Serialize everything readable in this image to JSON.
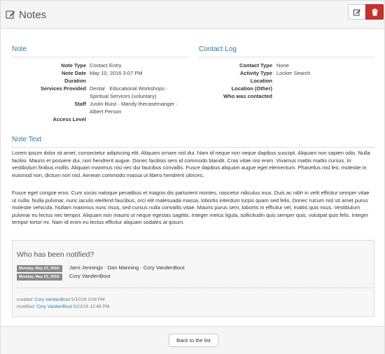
{
  "header": {
    "title": "Notes",
    "edit_icon": "edit-icon",
    "delete_icon": "trash-icon"
  },
  "note": {
    "title": "Note",
    "fields": {
      "note_type_label": "Note Type",
      "note_type_value": "Contact Entry",
      "note_date_label": "Note Date",
      "note_date_value": "May 10, 2016 3:07 PM",
      "duration_label": "Duration",
      "duration_value": "",
      "services_label": "Services Provided",
      "services_line1": "Dental · Educational Workshops ·",
      "services_line2": "Spiritual Services (voluntary)",
      "staff_label": "Staff",
      "staff_line1": "Justin Buist · Mandy thecasemanger ·",
      "staff_line2": "Albert Person",
      "access_label": "Access Level",
      "access_value": ""
    }
  },
  "contact_log": {
    "title": "Contact Log",
    "fields": {
      "contact_type_label": "Contact Type",
      "contact_type_value": "None",
      "activity_type_label": "Activity Type",
      "activity_type_value": "Locker Search",
      "location_label": "Location",
      "location_other_label": "Location (Other)",
      "who_contacted_label": "Who was contacted"
    }
  },
  "note_text": {
    "title": "Note Text",
    "paragraph1": "Lorem ipsum dolor sit amet, consectetur adipiscing elit. Aliquam ornare nisl dui. Nam id neque non neque dapibus suscipit. Aliquam non sapien odio. Nulla facilisi. Mauris et posuere dui, non hendrerit augue. Donec facilisis sem id commodo blandit. Cras vitae nisi enim. Vivamus mattis mattis cursus. In vestibulum finibus mollis. Aliquam maximus nisi nec dui faucibus convallis. Fusce dapibus aliquam augue eget elementum. Phasellus nisl leo, molestie in euismod non, dictum non nisl. Aenean commodo massa ut libero hendrerit ultrices.",
    "paragraph2": "Fusce eget congue eros. Cum sociis natoque penatibus et magnis dis parturient montes, nascetur ridiculus mus. Duis ac nibh in velit efficitur semper vitae ut nulla. Nulla pulvinar, nunc iaculis eleifend faucibus, orci elit malesuada massa, lobortis interdum turpis quam sed felis. Donec rutrum nisl sit amet purus molestie vehicula. Nullam maximus nunc risus, sed cursus nulla convallis vitae. Mauris purus sem, lobortis in efficitur vel, mattis quis risus. Vestibulum pulvinar eu lectus nec tempor. Aliquam non mauris ut neque egestas sagittis. Integer metus ligula, sollicitudin quis semper quis, volutpat quis felis. Integer tempor tortor mi. Nam id enim eu lectus efficitur aliquam sodales at ipsum."
  },
  "notified": {
    "title": "Who has been notified?",
    "entries": [
      {
        "date": "Monday, May 23, 2016:",
        "names": "Jami Jennings · Dan Manning · Cory VandenBout"
      },
      {
        "date": "Monday, May 23, 2016:",
        "names": "Cory VandenBout"
      }
    ],
    "created_label": "created:",
    "created_by": "Cory VandenBout",
    "created_date": "5/10/16 3:08 PM",
    "modified_label": "modified:",
    "modified_by": "Cory VandenBout",
    "modified_date": "5/23/16 12:48 PM"
  },
  "footer": {
    "back_label": "Back to the list"
  },
  "colors": {
    "accent": "#2a7bbd",
    "danger": "#c9302c",
    "badge": "#8a8a8a"
  }
}
